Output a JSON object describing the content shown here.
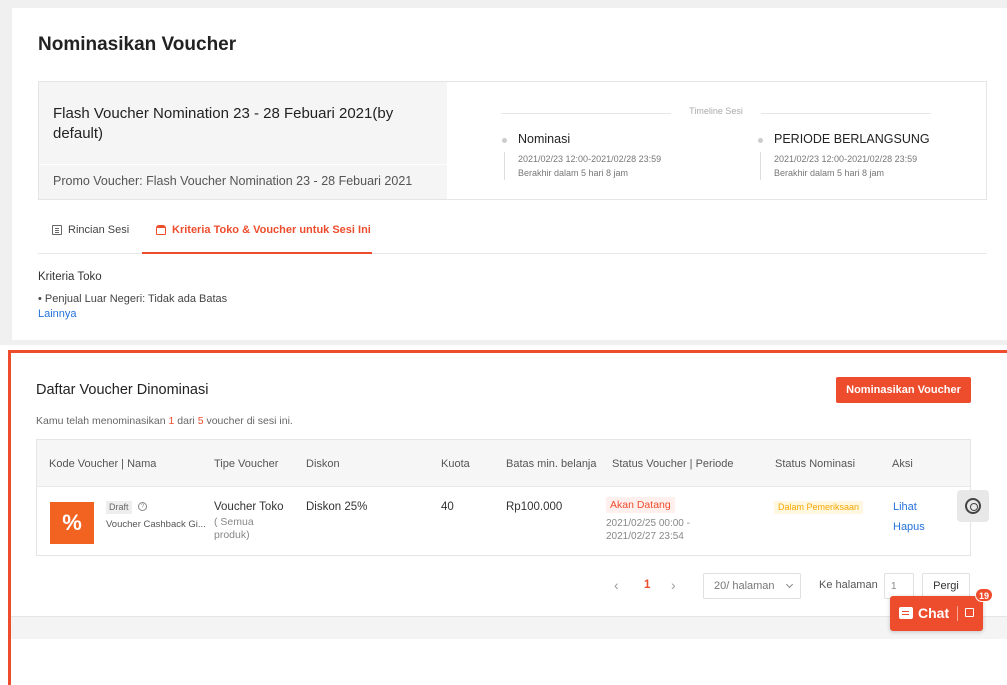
{
  "page": {
    "title": "Nominasikan Voucher"
  },
  "session": {
    "name": "Flash Voucher Nomination 23 - 28 Febuari 2021(by default)",
    "promo": "Promo Voucher: Flash Voucher Nomination 23 - 28 Febuari 2021",
    "timeline_label": "Timeline Sesi",
    "phases": [
      {
        "title": "Nominasi",
        "period": "2021/02/23 12:00-2021/02/28 23:59",
        "remaining": "Berakhir dalam 5 hari 8 jam"
      },
      {
        "title": "PERIODE BERLANGSUNG",
        "period": "2021/02/23 12:00-2021/02/28 23:59",
        "remaining": "Berakhir dalam 5 hari 8 jam"
      }
    ]
  },
  "tabs": [
    {
      "label": "Rincian Sesi",
      "icon": "document-icon",
      "active": false
    },
    {
      "label": "Kriteria Toko & Voucher untuk Sesi Ini",
      "icon": "shop-icon",
      "active": true
    }
  ],
  "criteria": {
    "title": "Kriteria Toko",
    "item": "• Penjual Luar Negeri: Tidak ada Batas",
    "more": "Lainnya"
  },
  "list": {
    "title": "Daftar Voucher Dinominasi",
    "sub_prefix": "Kamu telah menominasikan ",
    "sub_count": "1",
    "sub_mid": " dari ",
    "sub_total": "5",
    "sub_suffix": " voucher di sesi ini.",
    "nominate_button": "Nominasikan Voucher",
    "columns": [
      "Kode Voucher | Nama",
      "Tipe Voucher",
      "Diskon",
      "Kuota",
      "Batas min. belanja",
      "Status Voucher | Periode",
      "Status Nominasi",
      "Aksi"
    ],
    "rows": [
      {
        "image_symbol": "%",
        "badge": "Draft",
        "name": "Voucher Cashback Gi...",
        "type": "Voucher Toko",
        "type_sub": "( Semua produk)",
        "discount": "Diskon 25%",
        "quota": "40",
        "min_spend": "Rp100.000",
        "status": "Akan Datang",
        "period": "2021/02/25 00:00 - 2021/02/27 23:54",
        "nomination_status": "Dalam Pemeriksaan",
        "action_view": "Lihat",
        "action_delete": "Hapus"
      }
    ]
  },
  "pagination": {
    "prev": "‹",
    "current": "1",
    "next": "›",
    "per_page": "20/ halaman",
    "goto_label": "Ke halaman",
    "goto_value": "1",
    "goto_button": "Pergi"
  },
  "chat": {
    "label": "Chat",
    "count": "19"
  },
  "colors": {
    "accent": "#ee4d2d",
    "link": "#2673dd",
    "warning": "#f6a700"
  }
}
